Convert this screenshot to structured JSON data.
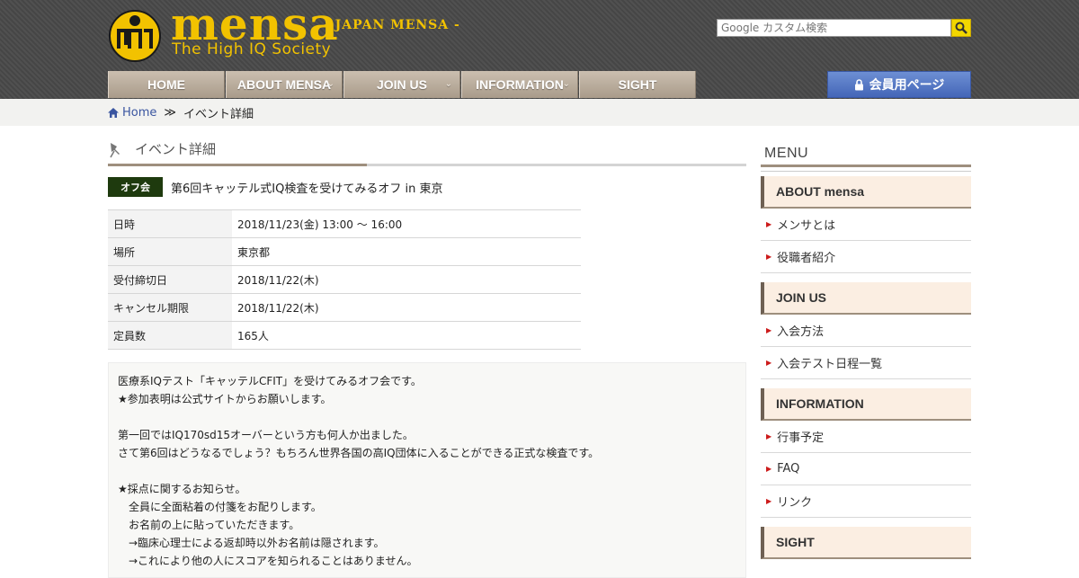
{
  "header": {
    "brand": "mensa",
    "tagline": "The High IQ Society",
    "subtitle": "- JAPAN MENSA -",
    "search_placeholder": "Google カスタム検索"
  },
  "nav": {
    "items": [
      {
        "label": "HOME",
        "dropdown": false
      },
      {
        "label": "ABOUT MENSA",
        "dropdown": true
      },
      {
        "label": "JOIN US",
        "dropdown": true
      },
      {
        "label": "INFORMATION",
        "dropdown": true
      },
      {
        "label": "SIGHT",
        "dropdown": false
      }
    ],
    "members_label": "会員用ページ"
  },
  "breadcrumb": {
    "home": "Home",
    "separator": "≫",
    "current": "イベント詳細"
  },
  "page": {
    "title": "イベント詳細",
    "event_tag": "オフ会",
    "event_title": "第6回キャッテル式IQ検査を受けてみるオフ in 東京"
  },
  "info_table": [
    {
      "label": "日時",
      "value": "2018/11/23(金)  13:00 ～ 16:00"
    },
    {
      "label": "場所",
      "value": "東京都"
    },
    {
      "label": "受付締切日",
      "value": "2018/11/22(木)"
    },
    {
      "label": "キャンセル期限",
      "value": "2018/11/22(木)"
    },
    {
      "label": "定員数",
      "value": "165人"
    }
  ],
  "description": [
    "医療系IQテスト「キャッテルCFIT」を受けてみるオフ会です。",
    "★参加表明は公式サイトからお願いします。",
    "",
    "第一回ではIQ170sd15オーバーという方も何人か出ました。",
    "さて第6回はどうなるでしょう？もちろん世界各国の高IQ団体に入ることができる正式な検査です。",
    "",
    "★採点に関するお知らせ。",
    "　全員に全面粘着の付箋をお配りします。",
    "　お名前の上に貼っていただきます。",
    "　→臨床心理士による返却時以外お名前は隠されます。",
    "　→これにより他の人にスコアを知られることはありません。"
  ],
  "sidebar": {
    "heading": "MENU",
    "sections": [
      {
        "title": "ABOUT mensa",
        "items": [
          "メンサとは",
          "役職者紹介"
        ]
      },
      {
        "title": "JOIN US",
        "items": [
          "入会方法",
          "入会テスト日程一覧"
        ]
      },
      {
        "title": "INFORMATION",
        "items": [
          "行事予定",
          "FAQ",
          "リンク"
        ]
      },
      {
        "title": "SIGHT",
        "items": []
      }
    ]
  },
  "colors": {
    "brand_yellow": "#f2c200",
    "header_bg": "#4a4a4a",
    "nav_tan": "#b3a594",
    "members_blue": "#4f72c4",
    "tag_green": "#1e3a0e",
    "sidebar_accent": "#fbeee2"
  }
}
